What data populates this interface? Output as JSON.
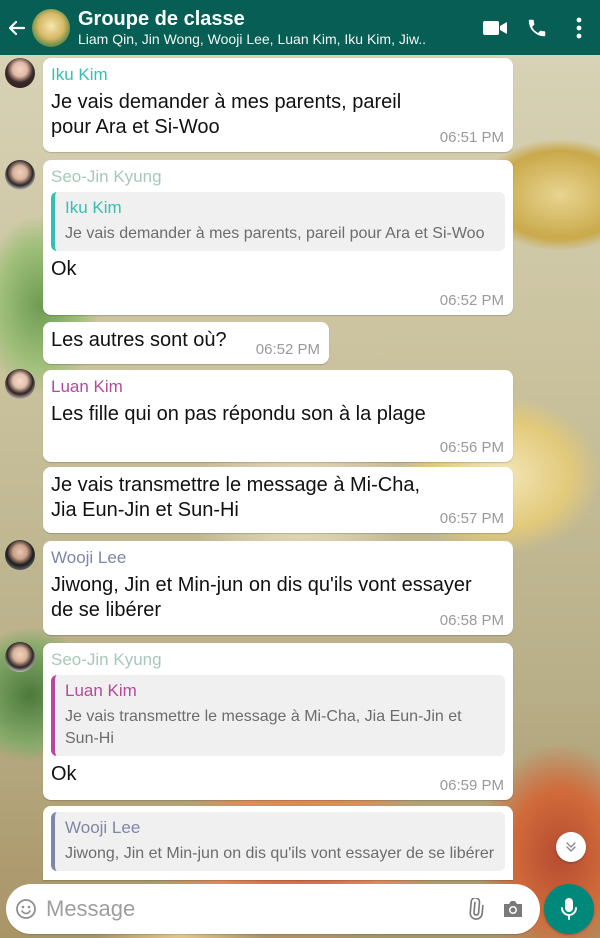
{
  "header": {
    "title": "Groupe de classe",
    "subtitle": "Liam Qin, Jin Wong, Wooji Lee, Luan Kim, Iku Kim, Jiw.."
  },
  "messages": [
    {
      "sender": "Iku Kim",
      "text": "Je vais demander à mes parents, pareil pour Ara et Si-Woo",
      "time": "06:51 PM"
    },
    {
      "sender": "Seo-Jin Kyung",
      "quote_sender": "Iku Kim",
      "quote_text": "Je vais demander à mes parents, pareil pour Ara et Si-Woo",
      "text": "Ok",
      "time": "06:52 PM"
    },
    {
      "text": "Les autres sont où?",
      "time": "06:52 PM"
    },
    {
      "sender": "Luan Kim",
      "text": "Les fille qui on pas répondu son à la plage",
      "time": "06:56 PM"
    },
    {
      "text": "Je vais transmettre le message à Mi-Cha, Jia Eun-Jin et Sun-Hi",
      "time": "06:57 PM"
    },
    {
      "sender": "Wooji Lee",
      "text": "Jiwong, Jin et Min-jun on dis qu'ils vont essayer de se libérer",
      "time": "06:58 PM"
    },
    {
      "sender": "Seo-Jin Kyung",
      "quote_sender": "Luan Kim",
      "quote_text": "Je vais transmettre le message à Mi-Cha, Jia Eun-Jin et Sun-Hi",
      "text": "Ok",
      "time": "06:59 PM"
    },
    {
      "quote_sender": "Wooji Lee",
      "quote_text": "Jiwong, Jin et Min-jun on dis qu'ils vont essayer de se libérer"
    }
  ],
  "input": {
    "placeholder": "Message"
  },
  "colors": {
    "header": "#075e54",
    "mic_button": "#00897b",
    "iku": "#35c0b2",
    "seo_jin": "#a7c8b8",
    "luan": "#b34a9b",
    "wooji": "#7f86a6"
  },
  "icons": [
    "back-arrow-icon",
    "video-call-icon",
    "phone-icon",
    "more-vert-icon",
    "chevron-down-icon",
    "emoji-icon",
    "attach-icon",
    "camera-icon",
    "mic-icon"
  ]
}
